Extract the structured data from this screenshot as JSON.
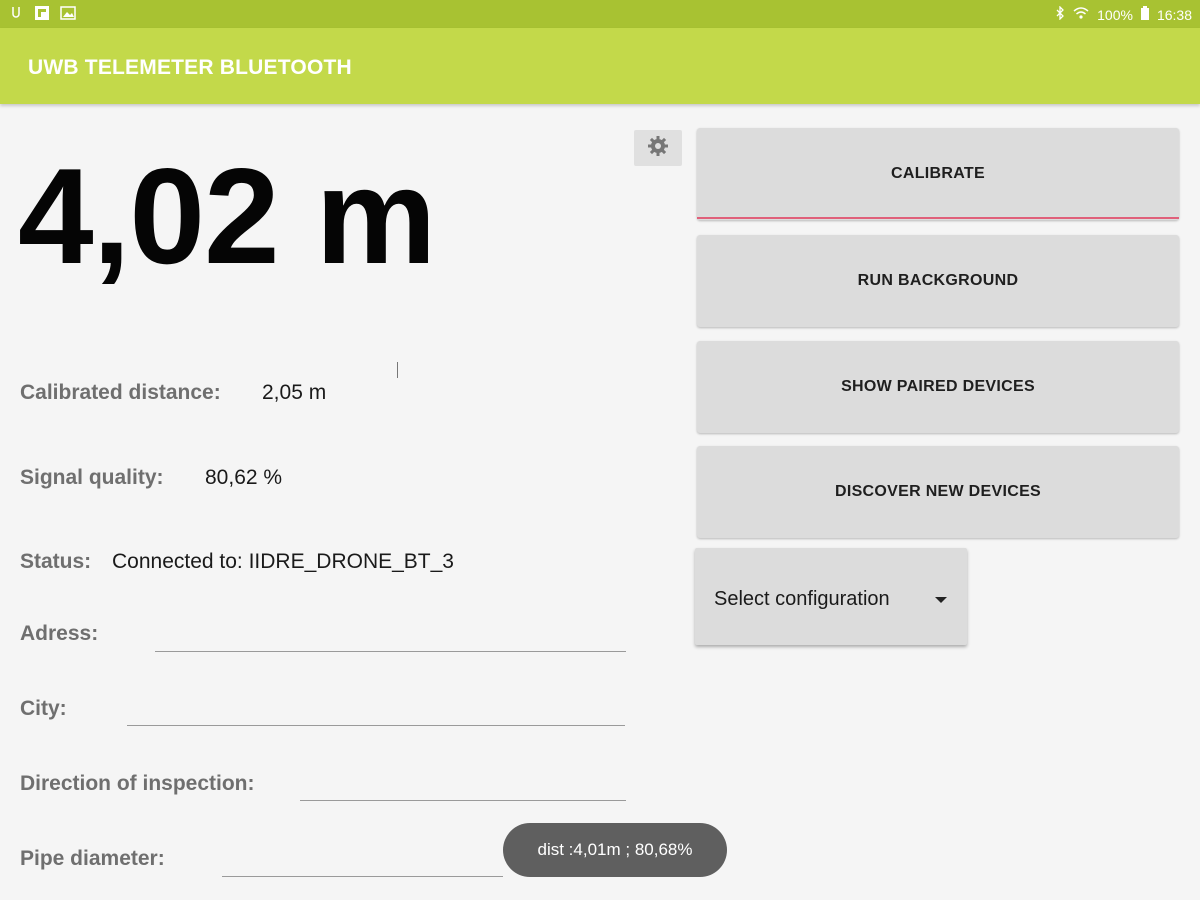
{
  "status_bar": {
    "battery": "100%",
    "time": "16:38"
  },
  "app_bar": {
    "title": "UWB TELEMETER BLUETOOTH"
  },
  "measurement": {
    "distance": "4,02 m"
  },
  "info": {
    "calibrated_label": "Calibrated distance:",
    "calibrated_value": "2,05 m",
    "signal_label": "Signal quality:",
    "signal_value": "80,62 %",
    "status_label": "Status:",
    "status_value": "Connected to: IIDRE_DRONE_BT_3"
  },
  "form": {
    "adress_label": "Adress:",
    "adress_value": "",
    "city_label": "City:",
    "city_value": "",
    "direction_label": "Direction of inspection:",
    "direction_value": "",
    "pipe_label": "Pipe diameter:",
    "pipe_value": ""
  },
  "buttons": {
    "calibrate": "CALIBRATE",
    "run_background": "RUN BACKGROUND",
    "show_paired": "SHOW PAIRED DEVICES",
    "discover_new": "DISCOVER NEW DEVICES"
  },
  "config_select": {
    "selected": "Select configuration"
  },
  "toast": {
    "message": "dist :4,01m ; 80,68%"
  },
  "icons": {
    "settings": "gear-icon",
    "bluetooth": "bluetooth-icon",
    "wifi": "wifi-icon",
    "battery": "battery-icon"
  },
  "colors": {
    "status_bar": "#a8c232",
    "app_bar": "#c3d94a",
    "accent_underline": "#e0607a"
  }
}
